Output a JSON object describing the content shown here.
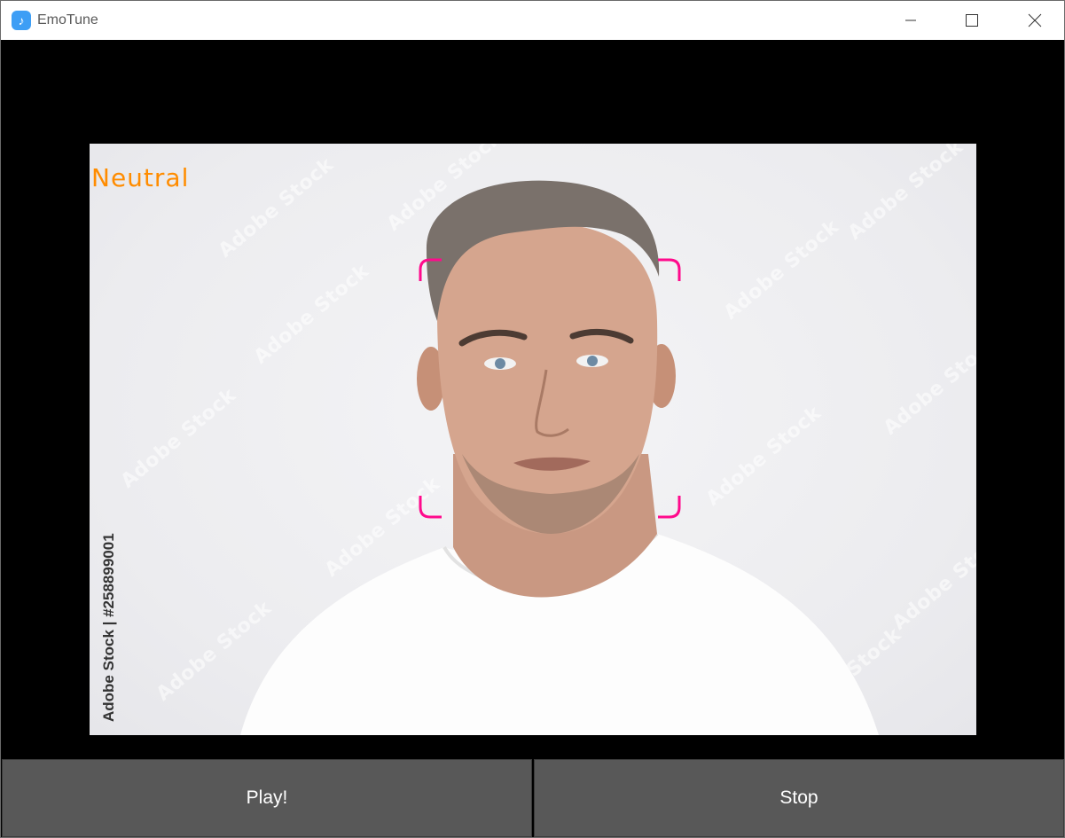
{
  "window": {
    "title": "EmoTune",
    "icon": "music-note-icon",
    "accent_color": "#3d9ef5"
  },
  "video": {
    "emotion_label": "Neutral",
    "emotion_color": "#ff8c00",
    "bracket_color": "#ff0a8c",
    "watermark_text": "Adobe Stock",
    "stock_id": "Adobe Stock | #258899001"
  },
  "controls": {
    "play_label": "Play!",
    "stop_label": "Stop",
    "button_color": "#585858"
  }
}
